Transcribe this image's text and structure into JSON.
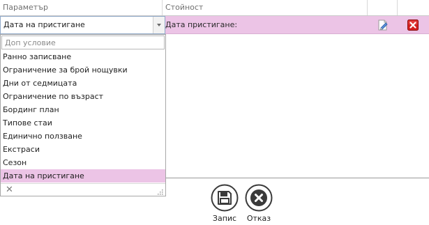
{
  "grid": {
    "columns": [
      "Параметър",
      "Стойност"
    ],
    "row": {
      "value_label": "Дата пристигане:"
    }
  },
  "combo": {
    "selected": "Дата на пристигане"
  },
  "dropdown": {
    "search_placeholder": "Доп условие",
    "items": [
      "Ранно записване",
      "Ограничение за брой нощувки",
      "Дни от седмицата",
      "Ограничение по възраст",
      "Бординг план",
      "Типове стаи",
      "Единично ползване",
      "Екстраси",
      "Сезон",
      "Дата на пристигане"
    ],
    "selected_index": 9,
    "close_glyph": "✕"
  },
  "actions": {
    "save_label": "Запис",
    "cancel_label": "Отказ"
  },
  "colors": {
    "selection": "#ecc4e6",
    "delete": "#d42020"
  },
  "icons": {
    "edit": "pencil-edit-icon",
    "delete": "red-x-delete-icon",
    "save": "floppy-disk-icon",
    "cancel": "circle-x-icon",
    "dropdown": "chevron-down-icon",
    "resize": "resize-grip-icon"
  }
}
